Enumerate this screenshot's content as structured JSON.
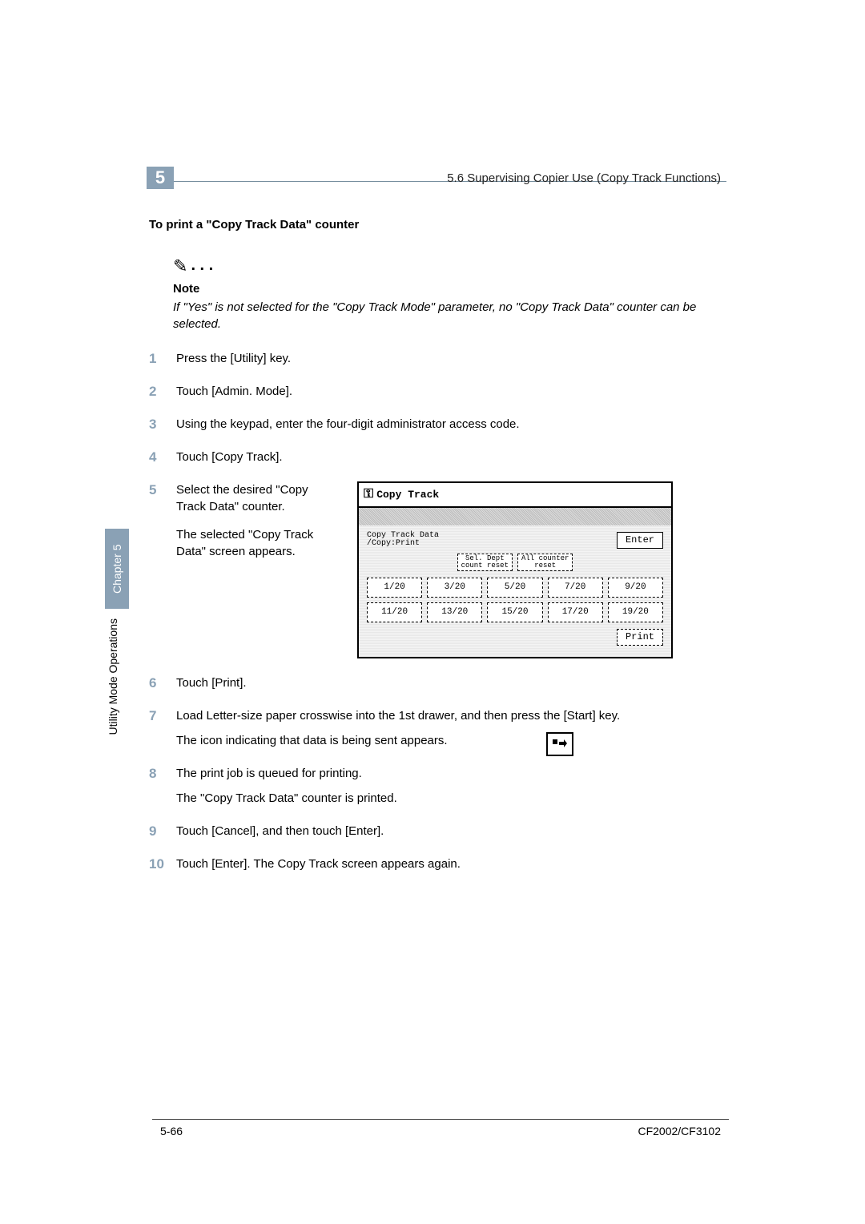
{
  "header": {
    "chapter_number": "5",
    "section_line": "5.6 Supervising Copier Use (Copy Track Functions)"
  },
  "title": "To print a \"Copy Track Data\" counter",
  "note": {
    "label": "Note",
    "body": "If \"Yes\" is not selected for the \"Copy Track Mode\" parameter, no \"Copy Track Data\" counter can be selected."
  },
  "steps": {
    "s1": "Press the [Utility] key.",
    "s2": "Touch [Admin. Mode].",
    "s3": "Using the keypad, enter the four-digit administrator access code.",
    "s4": "Touch [Copy Track].",
    "s5a": "Select the desired \"Copy Track Data\" counter.",
    "s5b": "The selected \"Copy Track Data\" screen appears.",
    "s6": "Touch [Print].",
    "s7a": "Load Letter-size paper crosswise into the 1st drawer, and then press the [Start] key.",
    "s7b": "The icon indicating that data is being sent appears.",
    "s8a": "The print job is queued for printing.",
    "s8b": "The \"Copy Track Data\" counter is printed.",
    "s9": "Touch [Cancel], and then touch [Enter].",
    "s10": "Touch [Enter]. The Copy Track screen appears again."
  },
  "screen": {
    "title": "Copy Track",
    "subtitle": "Copy Track Data\n/Copy:Print",
    "enter": "Enter",
    "mid1": "Sel. Dept\ncount reset",
    "mid2": "All counter\nreset",
    "cells": [
      "1/20",
      "3/20",
      "5/20",
      "7/20",
      "9/20",
      "11/20",
      "13/20",
      "15/20",
      "17/20",
      "19/20"
    ],
    "print": "Print"
  },
  "sidebar": {
    "tab": "Chapter 5",
    "text": "Utility Mode Operations"
  },
  "footer": {
    "left": "5-66",
    "right": "CF2002/CF3102"
  },
  "send_icon_glyph": "∎↵"
}
